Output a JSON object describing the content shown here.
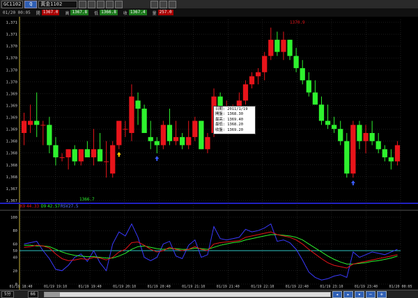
{
  "toolbar": {
    "symbol": "GC1102",
    "symbol_go": "Q",
    "contract": "黃金1102"
  },
  "quote": {
    "items": [
      {
        "label": "01/20 00:05",
        "value": ""
      },
      {
        "label": "開",
        "value": "1367.0"
      },
      {
        "label": "高",
        "value": "1367.8"
      },
      {
        "label": "低",
        "value": "1366.8"
      },
      {
        "label": "收",
        "value": "1367.4"
      },
      {
        "label": "量",
        "value": "257.0"
      }
    ]
  },
  "colors": {
    "up": "#e8141a",
    "down": "#2ef22e",
    "grid": "#3a3a3a",
    "axis": "#c8b43c",
    "volume_line": "#2020c0"
  },
  "price_axis": {
    "labels": [
      "1,371",
      "1,371",
      "1,370",
      "1,370",
      "1,370",
      "1,370",
      "1,369",
      "1,369",
      "1,369",
      "1,369",
      "1,368",
      "1,368",
      "1,368",
      "1,368",
      "1,367",
      "1,367"
    ]
  },
  "indicator_axis": {
    "labels": [
      "100",
      "80",
      "60",
      "50",
      "40",
      "20",
      "0"
    ]
  },
  "time_axis": {
    "labels": [
      "01/19 18:40",
      "01/19 19:10",
      "01/19 19:40",
      "01/19 20:10",
      "01/19 20:40",
      "01/19 21:10",
      "01/19 21:40",
      "01/19 22:10",
      "01/19 22:40",
      "01/19 23:10",
      "01/19 23:40",
      "01/20 00:05"
    ]
  },
  "annotations": {
    "high_label": "1370.9",
    "low_label": "1366.7"
  },
  "indicator_legend": {
    "k": {
      "label": "K9",
      "value": "44.33"
    },
    "d": {
      "label": "D9",
      "value": "42.57"
    },
    "rsv": {
      "label": "RSV",
      "value": "27.5"
    }
  },
  "tooltip": {
    "date": {
      "label": "日期",
      "value": "2011/1/19"
    },
    "open": {
      "label": "開盤",
      "value": "1368.30"
    },
    "high": {
      "label": "最高",
      "value": "1369.40"
    },
    "low": {
      "label": "最低",
      "value": "1368.20"
    },
    "close": {
      "label": "收盤",
      "value": "1369.20"
    }
  },
  "bottombar": {
    "left": "5分",
    "right": "66"
  },
  "chart_data": {
    "type": "candlestick",
    "y_range": [
      1366.6,
      1371.1
    ],
    "indicator_range": [
      0,
      100
    ],
    "candles": [
      {
        "o": 1368.3,
        "h": 1368.8,
        "l": 1368.0,
        "c": 1368.6
      },
      {
        "o": 1368.5,
        "h": 1369.0,
        "l": 1368.3,
        "c": 1368.6
      },
      {
        "o": 1368.6,
        "h": 1369.3,
        "l": 1368.2,
        "c": 1368.5
      },
      {
        "o": 1368.5,
        "h": 1368.6,
        "l": 1368.0,
        "c": 1368.5
      },
      {
        "o": 1368.5,
        "h": 1368.7,
        "l": 1367.8,
        "c": 1368.0
      },
      {
        "o": 1368.0,
        "h": 1368.2,
        "l": 1367.5,
        "c": 1367.7
      },
      {
        "o": 1367.7,
        "h": 1367.8,
        "l": 1367.6,
        "c": 1367.7
      },
      {
        "o": 1367.7,
        "h": 1367.9,
        "l": 1367.4,
        "c": 1367.9
      },
      {
        "o": 1367.9,
        "h": 1368.0,
        "l": 1367.5,
        "c": 1367.6
      },
      {
        "o": 1367.6,
        "h": 1367.9,
        "l": 1367.5,
        "c": 1367.9
      },
      {
        "o": 1367.9,
        "h": 1368.1,
        "l": 1367.7,
        "c": 1367.7
      },
      {
        "o": 1367.7,
        "h": 1368.4,
        "l": 1367.5,
        "c": 1367.9
      },
      {
        "o": 1367.9,
        "h": 1368.3,
        "l": 1367.7,
        "c": 1367.6
      },
      {
        "o": 1367.6,
        "h": 1368.1,
        "l": 1367.2,
        "c": 1367.6
      },
      {
        "o": 1367.3,
        "h": 1368.1,
        "l": 1367.2,
        "c": 1368.0
      },
      {
        "o": 1368.0,
        "h": 1368.6,
        "l": 1367.9,
        "c": 1368.6
      },
      {
        "o": 1368.4,
        "h": 1368.6,
        "l": 1368.2,
        "c": 1368.4
      },
      {
        "o": 1368.3,
        "h": 1369.5,
        "l": 1368.1,
        "c": 1369.2
      },
      {
        "o": 1369.1,
        "h": 1369.3,
        "l": 1368.5,
        "c": 1368.9
      },
      {
        "o": 1368.9,
        "h": 1369.0,
        "l": 1368.4,
        "c": 1368.3
      },
      {
        "o": 1368.2,
        "h": 1368.6,
        "l": 1367.9,
        "c": 1368.1
      },
      {
        "o": 1368.1,
        "h": 1368.2,
        "l": 1367.8,
        "c": 1368.0
      },
      {
        "o": 1368.0,
        "h": 1368.6,
        "l": 1367.9,
        "c": 1368.5
      },
      {
        "o": 1368.5,
        "h": 1368.9,
        "l": 1368.0,
        "c": 1368.1
      },
      {
        "o": 1368.1,
        "h": 1368.6,
        "l": 1368.0,
        "c": 1368.2
      },
      {
        "o": 1368.2,
        "h": 1368.3,
        "l": 1367.9,
        "c": 1368.0
      },
      {
        "o": 1368.0,
        "h": 1368.6,
        "l": 1367.9,
        "c": 1368.2
      },
      {
        "o": 1368.2,
        "h": 1368.7,
        "l": 1368.1,
        "c": 1368.6
      },
      {
        "o": 1368.6,
        "h": 1368.6,
        "l": 1367.9,
        "c": 1367.9
      },
      {
        "o": 1367.9,
        "h": 1368.3,
        "l": 1367.8,
        "c": 1368.2
      },
      {
        "o": 1368.3,
        "h": 1369.4,
        "l": 1368.2,
        "c": 1369.2
      },
      {
        "o": 1369.2,
        "h": 1369.3,
        "l": 1368.8,
        "c": 1368.9
      },
      {
        "o": 1368.9,
        "h": 1369.1,
        "l": 1368.8,
        "c": 1368.9
      },
      {
        "o": 1368.9,
        "h": 1369.0,
        "l": 1368.8,
        "c": 1368.9
      },
      {
        "o": 1368.9,
        "h": 1369.3,
        "l": 1368.8,
        "c": 1369.1
      },
      {
        "o": 1369.1,
        "h": 1369.6,
        "l": 1369.0,
        "c": 1369.5
      },
      {
        "o": 1369.5,
        "h": 1369.8,
        "l": 1369.4,
        "c": 1369.7
      },
      {
        "o": 1369.7,
        "h": 1369.9,
        "l": 1369.5,
        "c": 1369.8
      },
      {
        "o": 1369.8,
        "h": 1370.3,
        "l": 1369.6,
        "c": 1370.2
      },
      {
        "o": 1370.2,
        "h": 1370.9,
        "l": 1370.1,
        "c": 1370.6
      },
      {
        "o": 1370.6,
        "h": 1370.8,
        "l": 1370.2,
        "c": 1370.3
      },
      {
        "o": 1370.3,
        "h": 1370.8,
        "l": 1370.1,
        "c": 1370.6
      },
      {
        "o": 1370.6,
        "h": 1370.6,
        "l": 1370.1,
        "c": 1370.2
      },
      {
        "o": 1370.2,
        "h": 1370.4,
        "l": 1369.8,
        "c": 1369.9
      },
      {
        "o": 1369.9,
        "h": 1370.1,
        "l": 1369.5,
        "c": 1369.6
      },
      {
        "o": 1369.6,
        "h": 1369.8,
        "l": 1369.2,
        "c": 1369.3
      },
      {
        "o": 1369.3,
        "h": 1369.6,
        "l": 1369.0,
        "c": 1369.0
      },
      {
        "o": 1369.0,
        "h": 1369.2,
        "l": 1368.5,
        "c": 1368.6
      },
      {
        "o": 1368.6,
        "h": 1369.0,
        "l": 1368.4,
        "c": 1368.5
      },
      {
        "o": 1368.5,
        "h": 1368.7,
        "l": 1368.3,
        "c": 1368.4
      },
      {
        "o": 1368.4,
        "h": 1368.6,
        "l": 1368.0,
        "c": 1368.1
      },
      {
        "o": 1368.1,
        "h": 1368.3,
        "l": 1367.2,
        "c": 1367.3
      },
      {
        "o": 1367.3,
        "h": 1368.6,
        "l": 1367.2,
        "c": 1368.5
      },
      {
        "o": 1368.5,
        "h": 1368.6,
        "l": 1367.9,
        "c": 1368.1
      },
      {
        "o": 1368.1,
        "h": 1368.5,
        "l": 1367.8,
        "c": 1368.3
      },
      {
        "o": 1368.3,
        "h": 1368.6,
        "l": 1368.0,
        "c": 1368.1
      },
      {
        "o": 1368.1,
        "h": 1368.3,
        "l": 1367.8,
        "c": 1367.9
      },
      {
        "o": 1367.9,
        "h": 1368.0,
        "l": 1367.6,
        "c": 1367.7
      },
      {
        "o": 1367.7,
        "h": 1367.9,
        "l": 1367.4,
        "c": 1367.6
      },
      {
        "o": 1367.6,
        "h": 1368.1,
        "l": 1367.5,
        "c": 1368.0
      }
    ],
    "markers": [
      {
        "candle": 15,
        "type": "arrow-up",
        "color": "#ffcc00"
      },
      {
        "candle": 21,
        "type": "arrow-up",
        "color": "#3a5cff"
      },
      {
        "candle": 31,
        "type": "arrow-up",
        "color": "#ffcc00"
      },
      {
        "candle": 52,
        "type": "arrow-up",
        "color": "#3a5cff"
      }
    ],
    "k_series": [
      55,
      56,
      58,
      57,
      54,
      45,
      38,
      35,
      36,
      38,
      37,
      40,
      39,
      36,
      40,
      48,
      52,
      62,
      63,
      58,
      52,
      48,
      50,
      55,
      52,
      50,
      52,
      56,
      52,
      50,
      60,
      62,
      63,
      64,
      65,
      70,
      72,
      74,
      76,
      78,
      74,
      72,
      70,
      66,
      60,
      52,
      45,
      38,
      32,
      28,
      26,
      24,
      30,
      32,
      34,
      36,
      38,
      40,
      42,
      44
    ],
    "d_series": [
      58,
      58,
      57,
      57,
      56,
      52,
      48,
      45,
      43,
      42,
      41,
      41,
      40,
      39,
      39,
      42,
      46,
      52,
      56,
      57,
      55,
      53,
      52,
      53,
      53,
      52,
      52,
      54,
      53,
      52,
      55,
      58,
      60,
      62,
      63,
      66,
      68,
      70,
      72,
      74,
      74,
      73,
      72,
      70,
      66,
      60,
      54,
      48,
      42,
      37,
      33,
      30,
      30,
      31,
      32,
      34,
      35,
      37,
      39,
      42
    ],
    "rsv_series": [
      60,
      62,
      64,
      50,
      38,
      22,
      20,
      28,
      40,
      45,
      34,
      50,
      32,
      20,
      60,
      78,
      72,
      90,
      70,
      40,
      35,
      40,
      60,
      64,
      42,
      38,
      58,
      66,
      40,
      44,
      86,
      68,
      66,
      68,
      70,
      82,
      78,
      80,
      84,
      90,
      64,
      66,
      62,
      52,
      36,
      18,
      10,
      6,
      8,
      12,
      14,
      10,
      48,
      40,
      44,
      48,
      46,
      44,
      48,
      52
    ]
  }
}
